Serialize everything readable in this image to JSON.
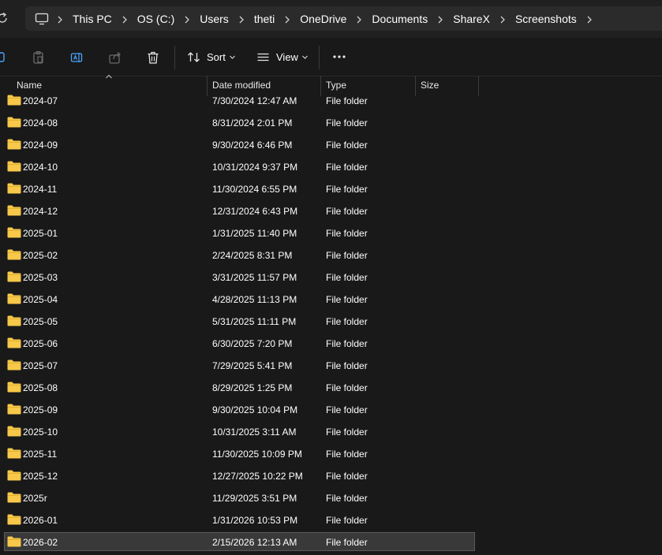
{
  "address_bar": {
    "crumbs": [
      "This PC",
      "OS (C:)",
      "Users",
      "theti",
      "OneDrive",
      "Documents",
      "ShareX",
      "Screenshots"
    ]
  },
  "toolbar": {
    "sort_label": "Sort",
    "view_label": "View"
  },
  "columns": {
    "name": "Name",
    "date_modified": "Date modified",
    "type": "Type",
    "size": "Size"
  },
  "files": [
    {
      "name": "2024-07",
      "date": "7/30/2024 12:47 AM",
      "type": "File folder"
    },
    {
      "name": "2024-08",
      "date": "8/31/2024 2:01 PM",
      "type": "File folder"
    },
    {
      "name": "2024-09",
      "date": "9/30/2024 6:46 PM",
      "type": "File folder"
    },
    {
      "name": "2024-10",
      "date": "10/31/2024 9:37 PM",
      "type": "File folder"
    },
    {
      "name": "2024-11",
      "date": "11/30/2024 6:55 PM",
      "type": "File folder"
    },
    {
      "name": "2024-12",
      "date": "12/31/2024 6:43 PM",
      "type": "File folder"
    },
    {
      "name": "2025-01",
      "date": "1/31/2025 11:40 PM",
      "type": "File folder"
    },
    {
      "name": "2025-02",
      "date": "2/24/2025 8:31 PM",
      "type": "File folder"
    },
    {
      "name": "2025-03",
      "date": "3/31/2025 11:57 PM",
      "type": "File folder"
    },
    {
      "name": "2025-04",
      "date": "4/28/2025 11:13 PM",
      "type": "File folder"
    },
    {
      "name": "2025-05",
      "date": "5/31/2025 11:11 PM",
      "type": "File folder"
    },
    {
      "name": "2025-06",
      "date": "6/30/2025 7:20 PM",
      "type": "File folder"
    },
    {
      "name": "2025-07",
      "date": "7/29/2025 5:41 PM",
      "type": "File folder"
    },
    {
      "name": "2025-08",
      "date": "8/29/2025 1:25 PM",
      "type": "File folder"
    },
    {
      "name": "2025-09",
      "date": "9/30/2025 10:04 PM",
      "type": "File folder"
    },
    {
      "name": "2025-10",
      "date": "10/31/2025 3:11 AM",
      "type": "File folder"
    },
    {
      "name": "2025-11",
      "date": "11/30/2025 10:09 PM",
      "type": "File folder"
    },
    {
      "name": "2025-12",
      "date": "12/27/2025 10:22 PM",
      "type": "File folder"
    },
    {
      "name": "2025r",
      "date": "11/29/2025 3:51 PM",
      "type": "File folder"
    },
    {
      "name": "2026-01",
      "date": "1/31/2026 10:53 PM",
      "type": "File folder"
    },
    {
      "name": "2026-02",
      "date": "2/15/2026 12:13 AM",
      "type": "File folder",
      "selected": true
    }
  ],
  "icons": {
    "refresh": "refresh-icon",
    "pc": "this-pc-icon",
    "folder": "folder-icon",
    "copy": "copy-icon",
    "paste": "paste-icon",
    "rename": "rename-icon",
    "share": "share-icon",
    "delete": "delete-icon",
    "sort": "sort-icon",
    "view": "view-icon",
    "more": "more-options-icon"
  },
  "colors": {
    "background": "#191919",
    "folder": "#f7c849",
    "selected_row": "#393939"
  }
}
